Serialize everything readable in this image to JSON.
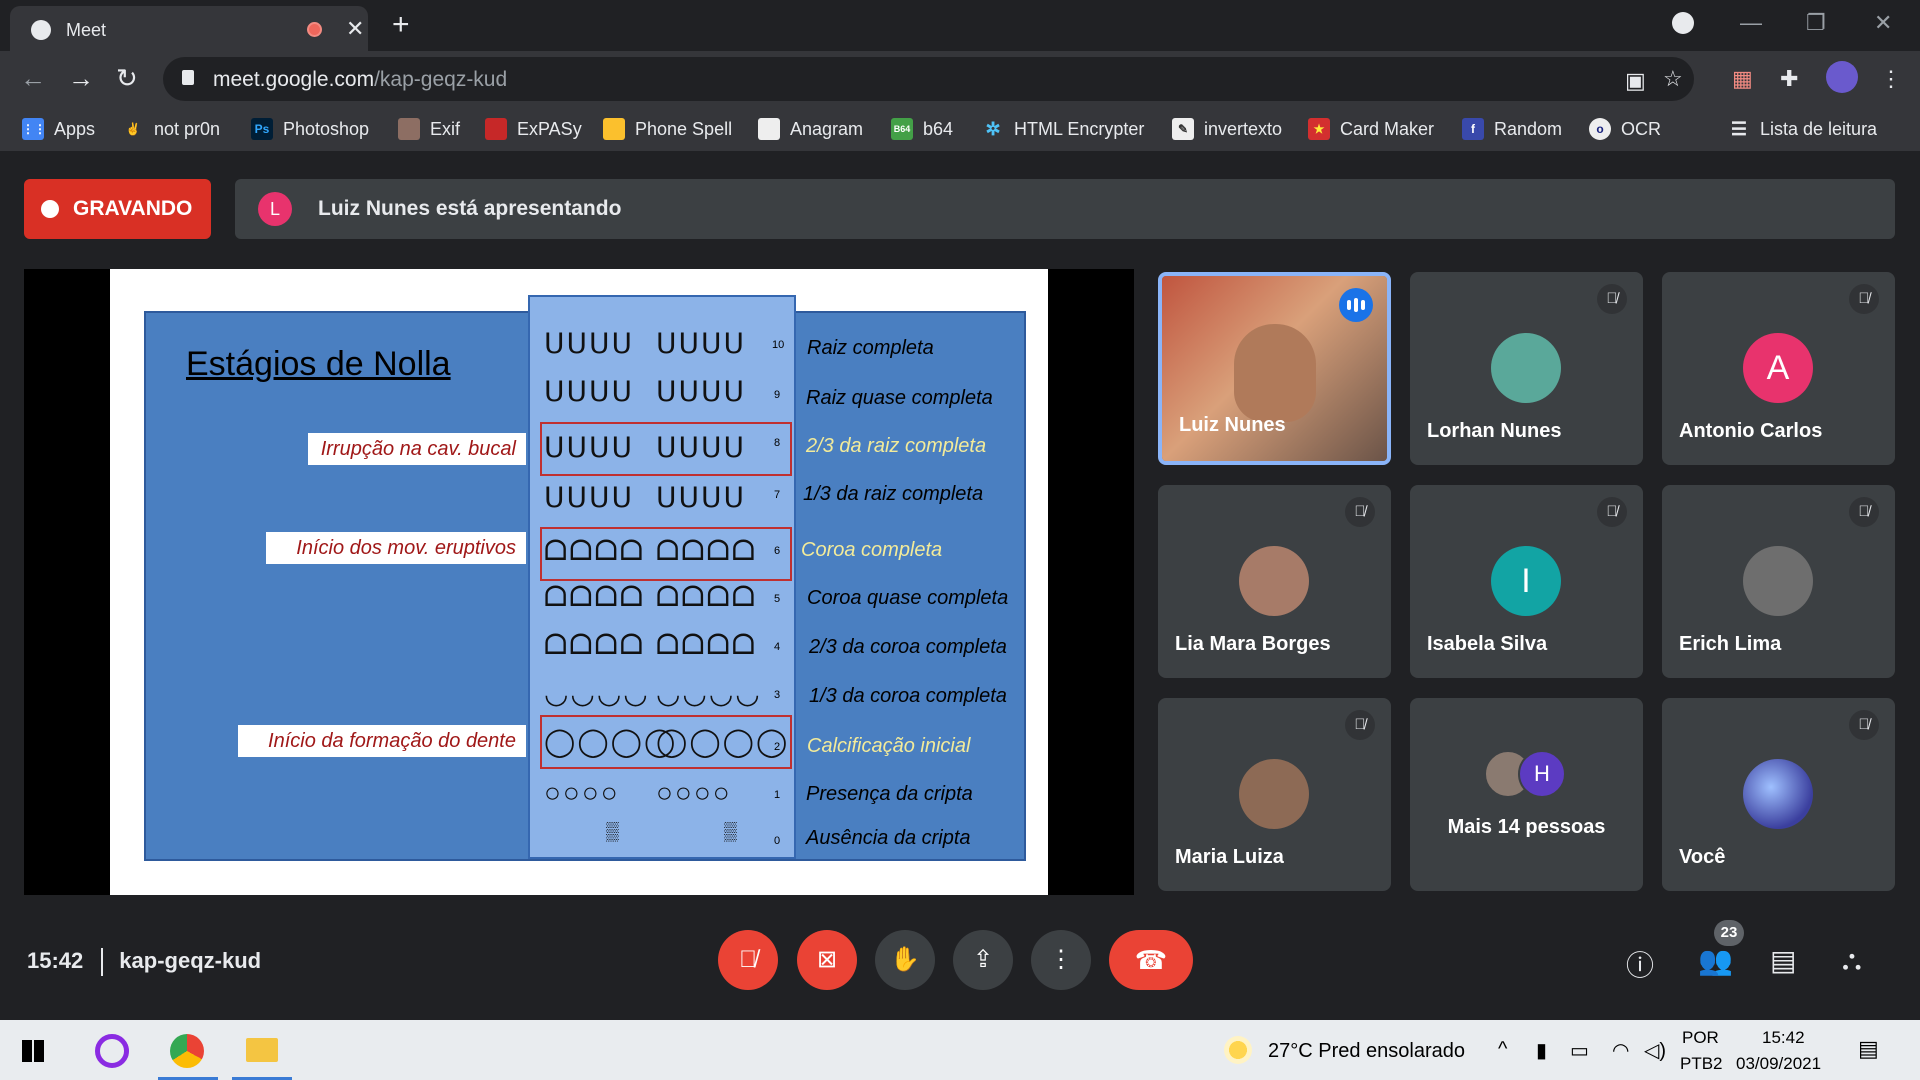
{
  "browser": {
    "tab_title": "Meet",
    "url_host": "meet.google.com",
    "url_path": "/kap-geqz-kud",
    "bookmarks": [
      "Apps",
      "not pr0n",
      "Photoshop",
      "Exif",
      "ExPASy",
      "Phone Spell",
      "Anagram",
      "b64",
      "HTML Encrypter",
      "invertexto",
      "Card Maker",
      "Random",
      "OCR"
    ],
    "reading_list": "Lista de leitura"
  },
  "meet": {
    "recording_label": "GRAVANDO",
    "presenter_initial": "L",
    "presenter_text": "Luiz Nunes está apresentando",
    "time": "15:42",
    "meeting_code": "kap-geqz-kud",
    "participant_count": "23"
  },
  "slide": {
    "title": "Estágios de Nolla",
    "stages": [
      {
        "num": "10",
        "label": "Raiz  completa"
      },
      {
        "num": "9",
        "label": "Raiz quase completa"
      },
      {
        "num": "8",
        "label": "2/3 da raiz completa"
      },
      {
        "num": "7",
        "label": "1/3 da raiz completa"
      },
      {
        "num": "6",
        "label": "Coroa completa"
      },
      {
        "num": "5",
        "label": "Coroa quase completa"
      },
      {
        "num": "4",
        "label": "2/3 da coroa completa"
      },
      {
        "num": "3",
        "label": "1/3 da coroa completa"
      },
      {
        "num": "2",
        "label": "Calcificação inicial"
      },
      {
        "num": "1",
        "label": "Presença da cripta"
      },
      {
        "num": "0",
        "label": "Ausência da cripta"
      }
    ],
    "callouts": [
      "Irrupção na cav. bucal",
      "Início dos mov. eruptivos",
      "Início da formação do dente"
    ]
  },
  "participants": [
    {
      "name": "Luiz Nunes",
      "initial": ""
    },
    {
      "name": "Lorhan Nunes",
      "initial": ""
    },
    {
      "name": "Antonio Carlos",
      "initial": "A"
    },
    {
      "name": "Lia Mara Borges",
      "initial": ""
    },
    {
      "name": "Isabela Silva",
      "initial": "I"
    },
    {
      "name": "Erich Lima",
      "initial": ""
    },
    {
      "name": "Maria Luiza",
      "initial": ""
    },
    {
      "name": "Mais 14 pessoas",
      "initial": "H"
    },
    {
      "name": "Você",
      "initial": ""
    }
  ],
  "taskbar": {
    "weather": "27°C  Pred ensolarado",
    "lang1": "POR",
    "lang2": "PTB2",
    "time": "15:42",
    "date": "03/09/2021"
  },
  "colors": {
    "record_red": "#d93025",
    "speaking_blue": "#1a73e8",
    "tile_bg": "#3c4043",
    "slide_blue": "#4a7fc1"
  }
}
